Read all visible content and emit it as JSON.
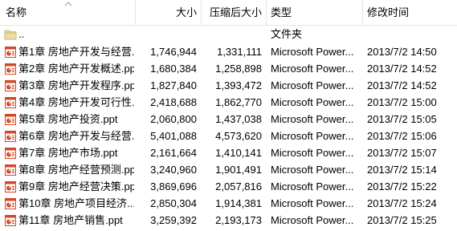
{
  "columns": {
    "name": "名称",
    "size": "大小",
    "compressed": "压缩后大小",
    "type": "类型",
    "modified": "修改时间"
  },
  "parent": {
    "name": "..",
    "type": "文件夹"
  },
  "files": [
    {
      "name": "第1章 房地产开发与经营...",
      "size": "1,746,944",
      "compressed": "1,331,111",
      "type": "Microsoft Power...",
      "modified": "2013/7/2 14:50"
    },
    {
      "name": "第2章 房地产开发概述.ppt",
      "size": "1,680,384",
      "compressed": "1,258,898",
      "type": "Microsoft Power...",
      "modified": "2013/7/2 14:52"
    },
    {
      "name": "第3章 房地产开发程序.ppt",
      "size": "1,827,840",
      "compressed": "1,393,472",
      "type": "Microsoft Power...",
      "modified": "2013/7/2 14:52"
    },
    {
      "name": "第4章 房地产开发可行性...",
      "size": "2,418,688",
      "compressed": "1,862,770",
      "type": "Microsoft Power...",
      "modified": "2013/7/2 15:00"
    },
    {
      "name": "第5章 房地产投资.ppt",
      "size": "2,060,800",
      "compressed": "1,437,038",
      "type": "Microsoft Power...",
      "modified": "2013/7/2 15:05"
    },
    {
      "name": "第6章 房地产开发与经营...",
      "size": "5,401,088",
      "compressed": "4,573,620",
      "type": "Microsoft Power...",
      "modified": "2013/7/2 15:06"
    },
    {
      "name": "第7章 房地产市场.ppt",
      "size": "2,161,664",
      "compressed": "1,410,141",
      "type": "Microsoft Power...",
      "modified": "2013/7/2 15:07"
    },
    {
      "name": "第8章 房地产经营预测.ppt",
      "size": "3,240,960",
      "compressed": "1,901,491",
      "type": "Microsoft Power...",
      "modified": "2013/7/2 15:14"
    },
    {
      "name": "第9章 房地产经营决策.ppt",
      "size": "3,869,696",
      "compressed": "2,057,816",
      "type": "Microsoft Power...",
      "modified": "2013/7/2 15:22"
    },
    {
      "name": "第10章 房地产项目经济...",
      "size": "2,850,304",
      "compressed": "1,914,381",
      "type": "Microsoft Power...",
      "modified": "2013/7/2 15:24"
    },
    {
      "name": "第11章 房地产销售.ppt",
      "size": "3,259,392",
      "compressed": "2,193,173",
      "type": "Microsoft Power...",
      "modified": "2013/7/2 15:25"
    }
  ],
  "icons": {
    "file": "powerpoint-file-icon",
    "parent": "folder-icon",
    "sort": "sort-ascending-icon"
  },
  "colors": {
    "ppt_icon": "#d24726",
    "folder_icon": "#e6d49a",
    "divider": "#e5e5e5"
  }
}
